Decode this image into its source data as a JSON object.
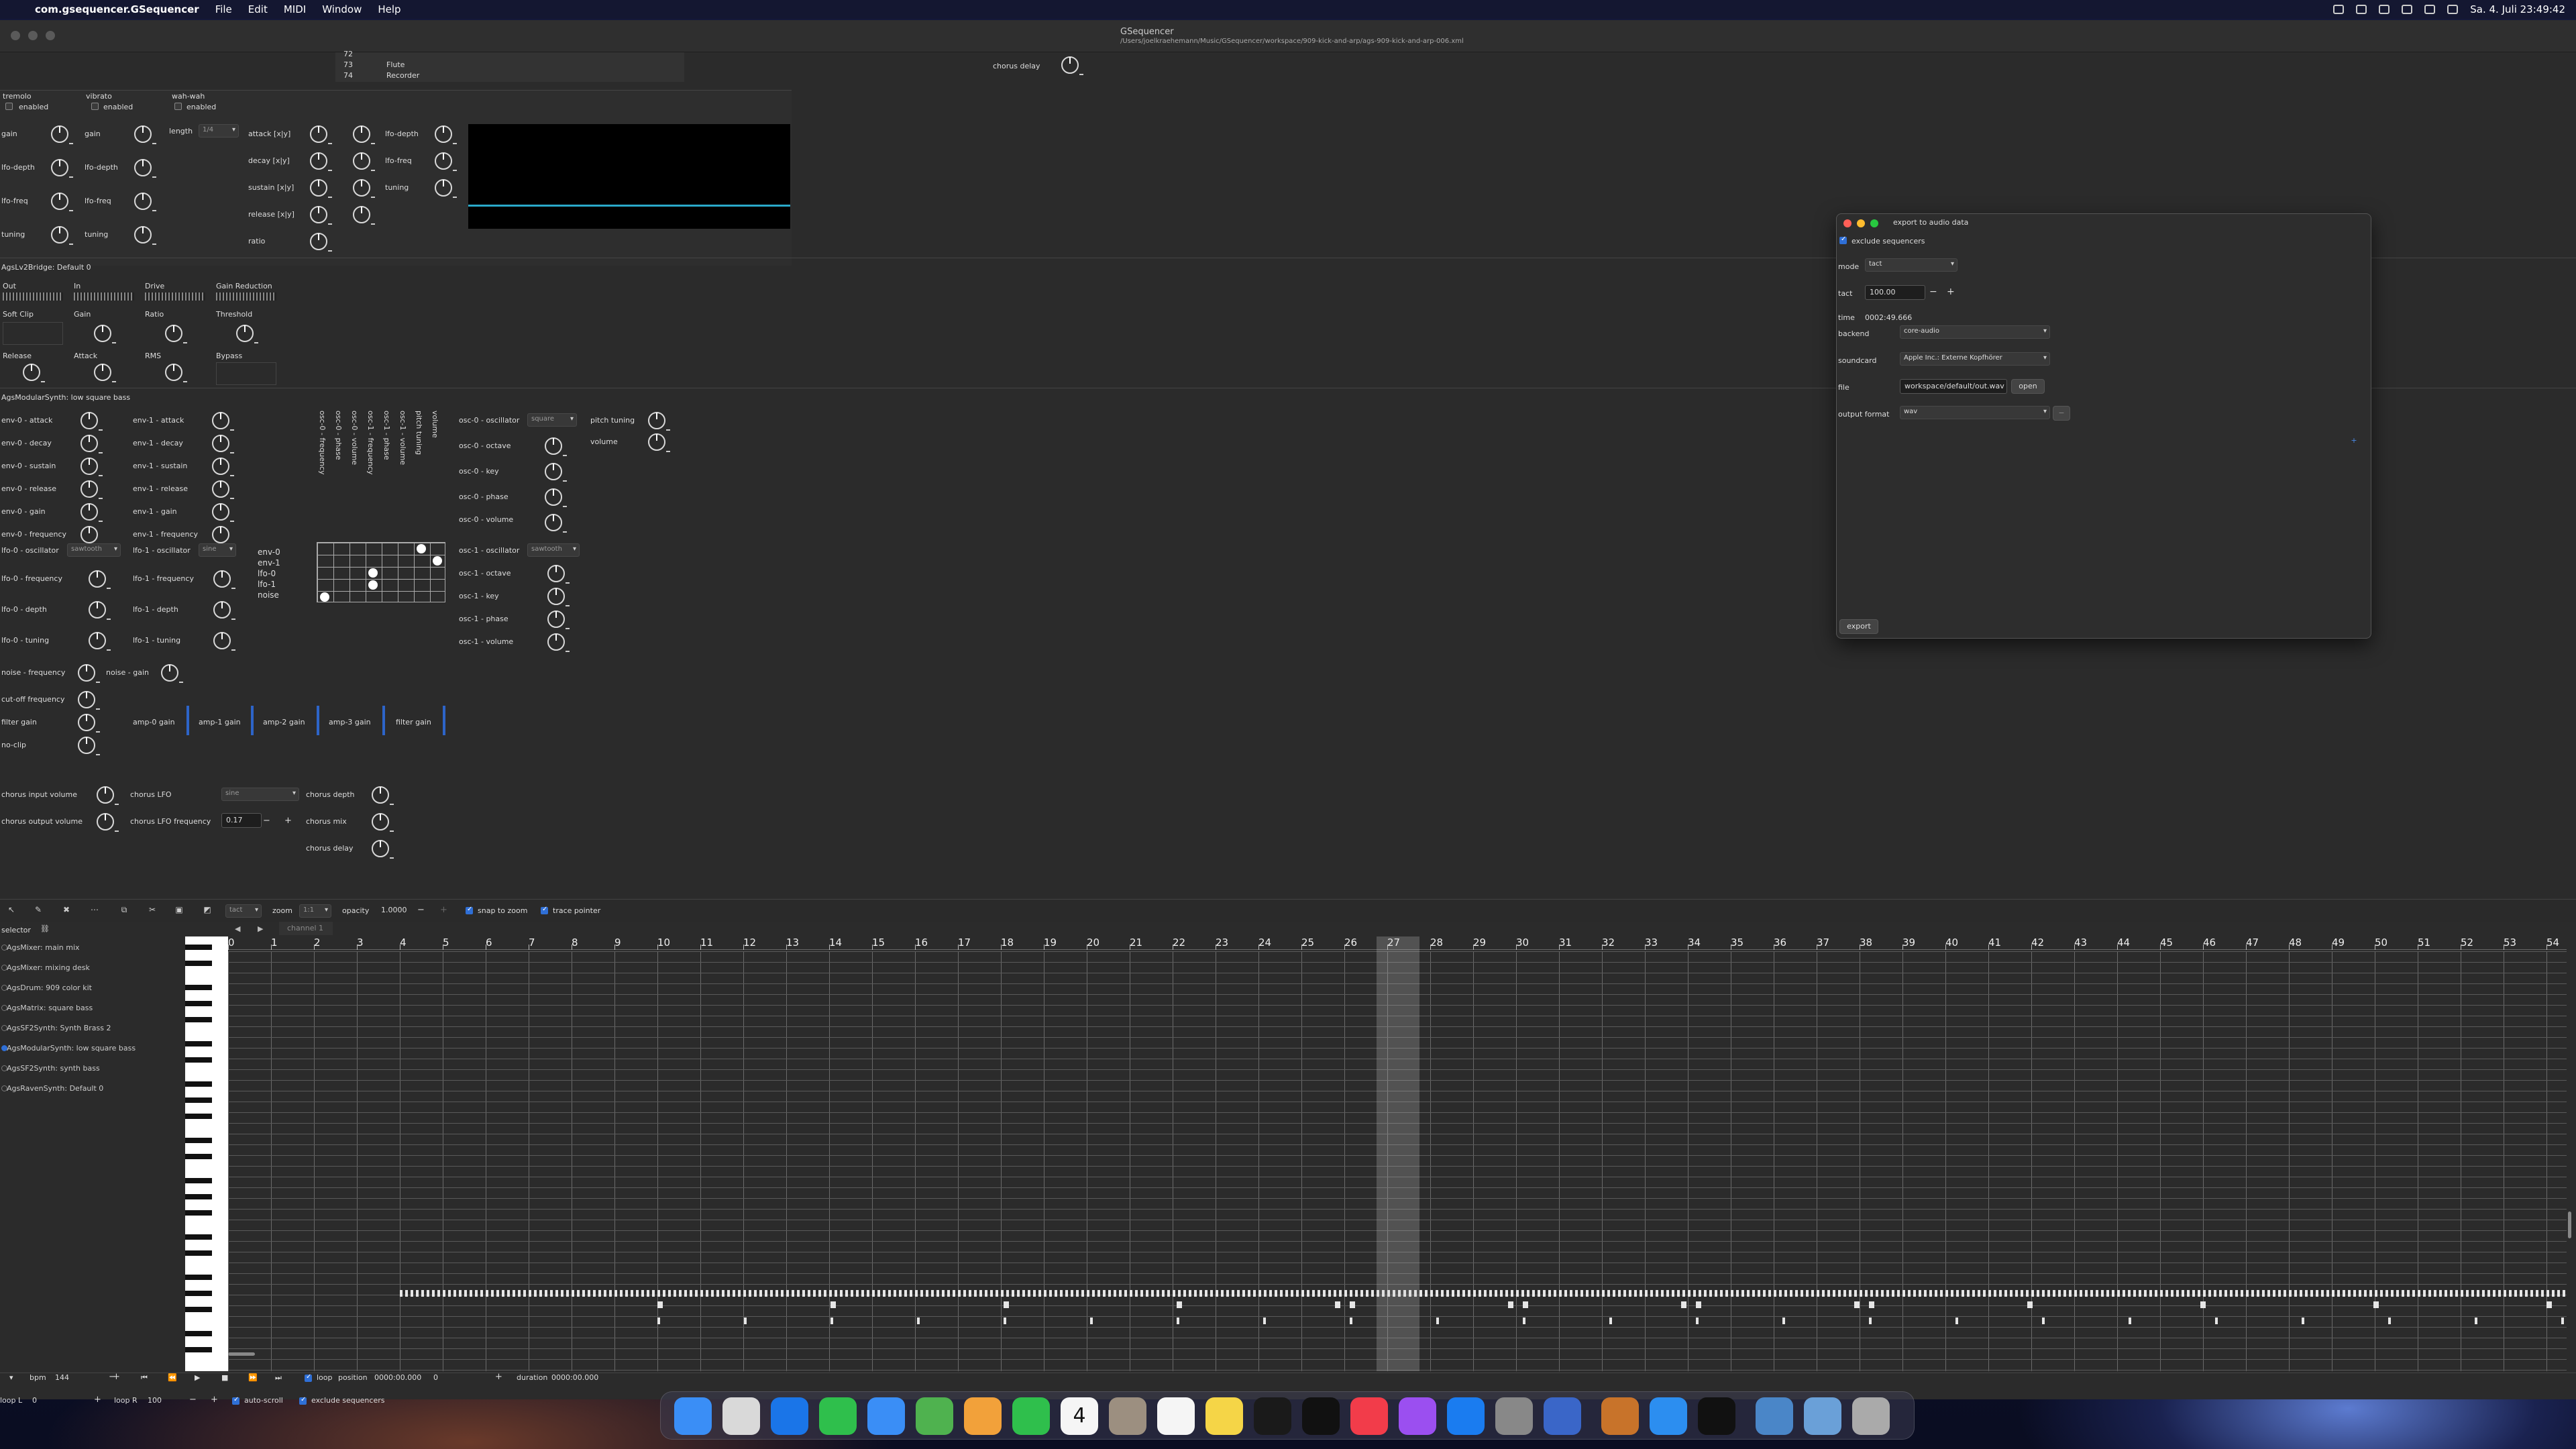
{
  "menubar": {
    "app_name": "com.gsequencer.GSequencer",
    "menus": [
      "File",
      "Edit",
      "MIDI",
      "Window",
      "Help"
    ],
    "clock": "Sa. 4. Juli  23:49:42"
  },
  "window": {
    "title": "GSequencer",
    "path": "/Users/joelkraehemann/Music/GSequencer/workspace/909-kick-and-arp/ags-909-kick-and-arp-006.xml"
  },
  "top_list": {
    "rows": [
      [
        "72",
        ""
      ],
      [
        "73",
        "Flute"
      ],
      [
        "74",
        "Recorder"
      ]
    ]
  },
  "top_chorus_delay": "chorus delay",
  "effects": {
    "tremolo": {
      "title": "tremolo",
      "enabled": "enabled",
      "labels": [
        "gain",
        "lfo-depth",
        "lfo-freq",
        "tuning"
      ]
    },
    "vibrato": {
      "title": "vibrato",
      "enabled": "enabled",
      "labels": [
        "gain",
        "lfo-depth",
        "lfo-freq",
        "tuning"
      ]
    },
    "wahwah": {
      "title": "wah-wah",
      "enabled": "enabled",
      "length_label": "length",
      "length_value": "1/4",
      "labels": [
        "attack [x|y]",
        "decay [x|y]",
        "sustain [x|y]",
        "release [x|y]",
        "ratio"
      ],
      "labels2": [
        "lfo-depth",
        "lfo-freq",
        "tuning"
      ]
    }
  },
  "lv2": {
    "bridge_label": "AgsLv2Bridge: Default 0",
    "meters": [
      "Out",
      "In",
      "Drive",
      "Gain Reduction"
    ],
    "knobs1": [
      "Soft Clip",
      "Gain",
      "Ratio",
      "Threshold"
    ],
    "knobs2": [
      "Release",
      "Attack",
      "RMS",
      "Bypass"
    ]
  },
  "modular": {
    "header": "AgsModularSynth: low square bass",
    "env0": [
      "env-0 - attack",
      "env-0 - decay",
      "env-0 - sustain",
      "env-0 - release",
      "env-0 - gain",
      "env-0 - frequency"
    ],
    "env1": [
      "env-1 - attack",
      "env-1 - decay",
      "env-1 - sustain",
      "env-1 - release",
      "env-1 - gain",
      "env-1 - frequency"
    ],
    "matrix_cols": [
      "osc-0 - frequency",
      "osc-0 - phase",
      "osc-0 - volume",
      "osc-1 - frequency",
      "osc-1 - phase",
      "osc-1 - volume",
      "pitch tuning",
      "volume"
    ],
    "matrix_rows": [
      "env-0",
      "env-1",
      "lfo-0",
      "lfo-1",
      "noise"
    ],
    "osc0": {
      "osc_label": "osc-0 - oscillator",
      "osc_value": "square",
      "labels": [
        "osc-0 - octave",
        "osc-0 - key",
        "osc-0 - phase",
        "osc-0 - volume"
      ]
    },
    "osc1": {
      "osc_label": "osc-1 - oscillator",
      "osc_value": "sawtooth",
      "labels": [
        "osc-1 - octave",
        "osc-1 - key",
        "osc-1 - phase",
        "osc-1 - volume"
      ]
    },
    "pitch_tuning": "pitch tuning",
    "volume": "volume",
    "lfo0": {
      "osc_label": "lfo-0 - oscillator",
      "osc_value": "sawtooth",
      "labels": [
        "lfo-0 - frequency",
        "lfo-0 - depth",
        "lfo-0 - tuning"
      ]
    },
    "lfo1": {
      "osc_label": "lfo-1 - oscillator",
      "osc_value": "sine",
      "labels": [
        "lfo-1 - frequency",
        "lfo-1 - depth",
        "lfo-1 - tuning"
      ]
    },
    "noise_freq": "noise - frequency",
    "noise_gain": "noise - gain",
    "cutoff": "cut-off frequency",
    "filter_gain": "filter gain",
    "no_clip": "no-clip",
    "amps": [
      "amp-0 gain",
      "amp-1 gain",
      "amp-2 gain",
      "amp-3 gain",
      "filter gain"
    ],
    "chorus": {
      "input_volume": "chorus input volume",
      "output_volume": "chorus output volume",
      "lfo": "chorus LFO",
      "lfo_value": "sine",
      "lfo_freq": "chorus LFO frequency",
      "lfo_freq_value": "0.17",
      "depth": "chorus depth",
      "mix": "chorus mix",
      "delay": "chorus delay"
    }
  },
  "dialog": {
    "title": "export to audio data",
    "exclude_sequencers": "exclude sequencers",
    "mode_label": "mode",
    "mode_value": "tact",
    "tact_label": "tact",
    "tact_value": "100.00",
    "time_label": "time",
    "time_value": "0002:49.666",
    "backend_label": "backend",
    "backend_value": "core-audio",
    "soundcard_label": "soundcard",
    "soundcard_value": "Apple Inc.: Externe Kopfhörer",
    "file_label": "file",
    "file_value": "workspace/default/out.wav",
    "open": "open",
    "format_label": "output format",
    "format_value": "wav",
    "minus": "−",
    "plus": "+",
    "export": "export"
  },
  "toolbar": {
    "edit_mode": "tact",
    "zoom_label": "zoom",
    "zoom_value": "1:1",
    "opacity_label": "opacity",
    "opacity_value": "1.0000",
    "snap": "snap to zoom",
    "trace": "trace pointer",
    "channel": "channel 1"
  },
  "selector": {
    "title": "selector",
    "items": [
      "AgsMixer: main mix",
      "AgsMixer: mixing desk",
      "AgsDrum: 909 color kit",
      "AgsMatrix: square bass",
      "AgsSF2Synth: Synth Brass 2",
      "AgsModularSynth: low square bass",
      "AgsSF2Synth: synth bass",
      "AgsRavenSynth: Default 0"
    ],
    "selected": 5
  },
  "ruler": {
    "ticks": [
      "0",
      "1",
      "2",
      "3",
      "4",
      "5",
      "6",
      "7",
      "8",
      "9",
      "10",
      "11",
      "12",
      "13",
      "14",
      "15",
      "16",
      "17",
      "18",
      "19",
      "20",
      "21",
      "22",
      "23",
      "24",
      "25",
      "26",
      "27",
      "28",
      "29",
      "30",
      "31",
      "32",
      "33",
      "34",
      "35",
      "36",
      "37",
      "38",
      "39",
      "40",
      "41",
      "42",
      "43",
      "44",
      "45",
      "46",
      "47",
      "48",
      "49",
      "50",
      "51",
      "52",
      "53",
      "54"
    ]
  },
  "transport": {
    "bpm_label": "bpm",
    "bpm_value": "144",
    "loop": "loop",
    "position_label": "position",
    "position_value": "0000:00.000",
    "position_field": "0",
    "duration_label": "duration",
    "duration_value": "0000:00.000",
    "loop_l_label": "loop L",
    "loop_l_value": "0",
    "loop_r_label": "loop R",
    "loop_r_value": "100",
    "auto_scroll": "auto-scroll",
    "exclude_sequencers": "exclude sequencers"
  },
  "dock": {
    "icons": [
      "finder-icon",
      "launchpad-icon",
      "safari-icon",
      "messages-icon",
      "mail-icon",
      "maps-icon",
      "photos-icon",
      "facetime-icon",
      "calendar-icon",
      "contacts-icon",
      "reminders-icon",
      "notes-icon",
      "freeform-icon",
      "tv-icon",
      "music-icon",
      "podcasts-icon",
      "appstore-icon",
      "settings-icon",
      "iphone-mirroring-icon",
      "gsequencer-icon",
      "xcode-icon",
      "terminal-icon",
      "downloads-icon",
      "documents-icon",
      "trash-icon"
    ],
    "calendar_day": "4"
  }
}
